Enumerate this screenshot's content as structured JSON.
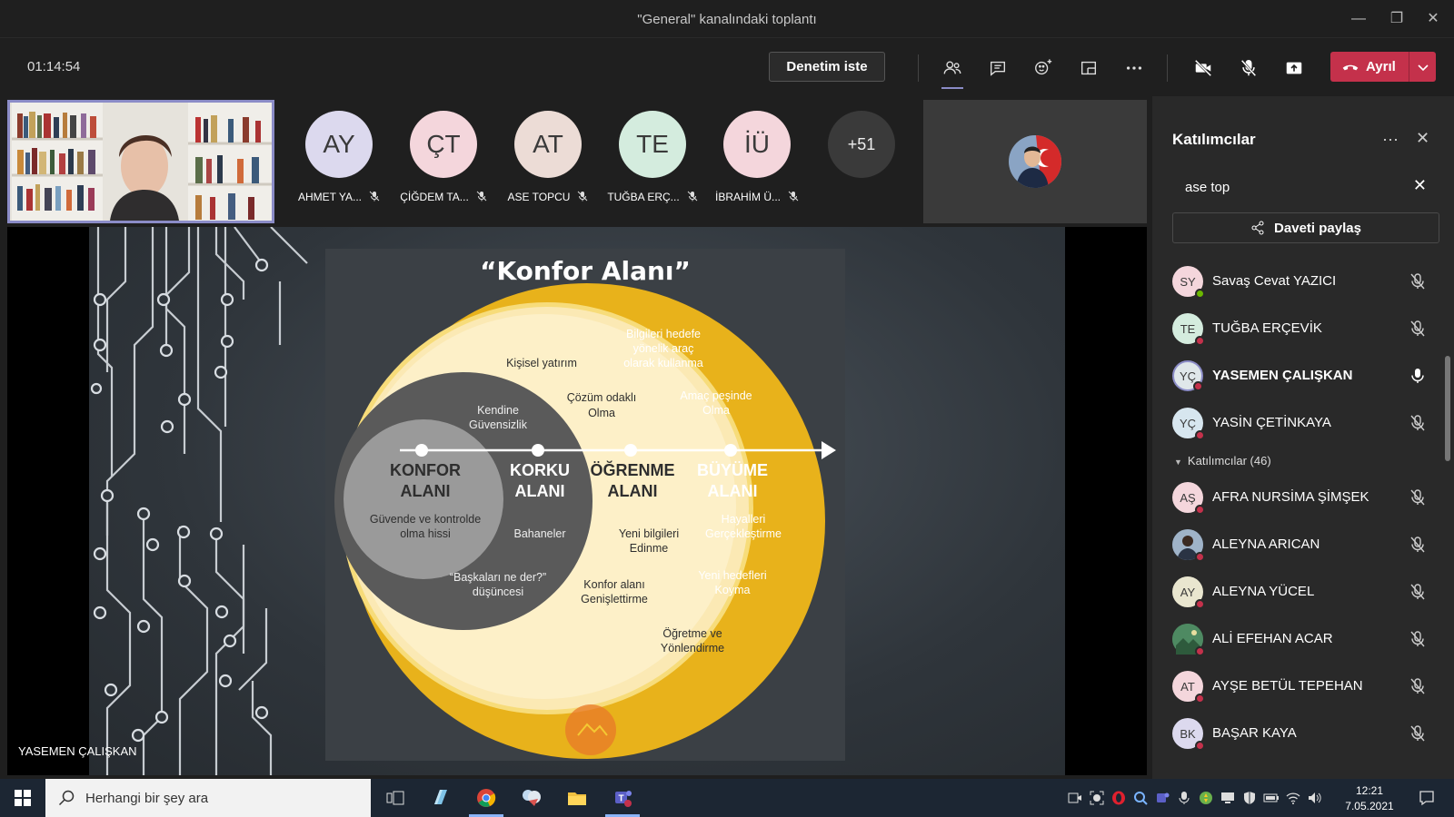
{
  "window": {
    "title": "\"General\" kanalındaki toplantı"
  },
  "toolbar": {
    "timer": "01:14:54",
    "request_control_label": "Denetim iste",
    "leave_label": "Ayrıl"
  },
  "presenter": {
    "name": "YASEMEN ÇALIŞKAN"
  },
  "strip": {
    "participants": [
      {
        "initials": "AY",
        "name": "AHMET YA...",
        "color": "#dcd9ee"
      },
      {
        "initials": "ÇT",
        "name": "ÇİĞDEM TA...",
        "color": "#f4d6dc"
      },
      {
        "initials": "AT",
        "name": "ASE TOPCU",
        "color": "#ecdcd6"
      },
      {
        "initials": "TE",
        "name": "TUĞBA ERÇ...",
        "color": "#d4ecde"
      },
      {
        "initials": "İÜ",
        "name": "İBRAHİM Ü...",
        "color": "#f4d6dc"
      }
    ],
    "overflow": "+51"
  },
  "slide": {
    "title": "“Konfor Alanı”",
    "zones": {
      "konfor": "KONFOR",
      "konfor2": "ALANI",
      "korku": "KORKU",
      "korku2": "ALANI",
      "ogrenme": "ÖĞRENME",
      "ogrenme2": "ALANI",
      "buyume": "BÜYÜME",
      "buyume2": "ALANI"
    },
    "notes": {
      "konfor_a": "Güvende ve kontrolde",
      "konfor_b": "olma hissi",
      "guvensizlik_a": "Kendine",
      "guvensizlik_b": "Güvensizlik",
      "bahaneler": "Bahaneler",
      "baskalari_a": "“Başkaları ne der?”",
      "baskalari_b": "düşüncesi",
      "kisisel": "Kişisel yatırım",
      "cozum_a": "Çözüm odaklı",
      "cozum_b": "Olma",
      "bilgi_a": "Bilgileri hedefe",
      "bilgi_b": "yönelik araç",
      "bilgi_c": "olarak kullanma",
      "amac_a": "Amaç peşinde",
      "amac_b": "Olma",
      "yeni_bilgi_a": "Yeni bilgileri",
      "yeni_bilgi_b": "Edinme",
      "konfor_genis_a": "Konfor alanı",
      "konfor_genis_b": "Genişlettirme",
      "hayaller_a": "Hayalleri",
      "hayaller_b": "Gerçekleştirme",
      "hedef_a": "Yeni hedefleri",
      "hedef_b": "Koyma",
      "ogretme_a": "Öğretme ve",
      "ogretme_b": "Yönlendirme"
    }
  },
  "panel": {
    "title": "Katılımcılar",
    "search_value": "ase top",
    "invite_label": "Daveti paylaş",
    "top_people": [
      {
        "initials": "SY",
        "name": "Savaş Cevat YAZICI",
        "color": "#f4d6dc",
        "status": "#6bb700",
        "mic": "off",
        "bold": false
      },
      {
        "initials": "TE",
        "name": "TUĞBA ERÇEVİK",
        "color": "#d4ecde",
        "status": "#c4314b",
        "mic": "off",
        "bold": false
      },
      {
        "initials": "YÇ",
        "name": "YASEMEN ÇALIŞKAN",
        "color": "#dfe7ea",
        "status": "#c4314b",
        "mic": "on",
        "bold": true
      },
      {
        "initials": "YÇ",
        "name": "YASİN ÇETİNKAYA",
        "color": "#d7e6ef",
        "status": "#c4314b",
        "mic": "off",
        "bold": false
      }
    ],
    "section_label": "Katılımcılar (46)",
    "people": [
      {
        "initials": "AŞ",
        "name": "AFRA NURSİMA ŞİMŞEK",
        "color": "#f4d6dc",
        "status": "#c4314b"
      },
      {
        "initials": "",
        "name": "ALEYNA ARICAN",
        "color": "#5a6b82",
        "status": "#c4314b"
      },
      {
        "initials": "AY",
        "name": "ALEYNA YÜCEL",
        "color": "#e9e6cf",
        "status": "#c4314b"
      },
      {
        "initials": "",
        "name": "ALİ EFEHAN ACAR",
        "color": "#3f7a55",
        "status": "#c4314b"
      },
      {
        "initials": "AT",
        "name": "AYŞE BETÜL TEPEHAN",
        "color": "#f4d6dc",
        "status": "#c4314b"
      },
      {
        "initials": "BK",
        "name": "BAŞAR KAYA",
        "color": "#dcd9ee",
        "status": "#c4314b"
      }
    ]
  },
  "taskbar": {
    "search_placeholder": "Herhangi bir şey ara",
    "time": "12:21",
    "date": "7.05.2021"
  }
}
